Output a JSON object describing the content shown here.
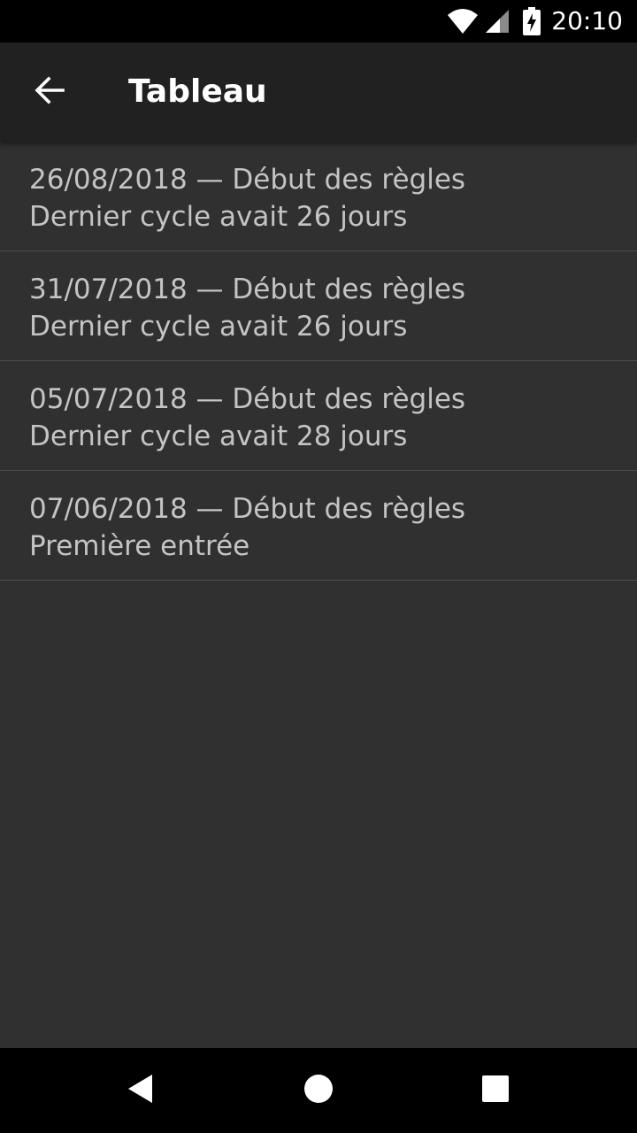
{
  "status_bar": {
    "time": "20:10",
    "icons": [
      "wifi-icon",
      "cell-signal-icon",
      "battery-charging-icon"
    ]
  },
  "app_bar": {
    "back_icon": "arrow-back-icon",
    "title": "Tableau"
  },
  "entries": [
    {
      "line1": "26/08/2018 — Début des règles",
      "line2": "Dernier cycle avait 26 jours"
    },
    {
      "line1": "31/07/2018 — Début des règles",
      "line2": "Dernier cycle avait 26 jours"
    },
    {
      "line1": "05/07/2018 — Début des règles",
      "line2": "Dernier cycle avait 28 jours"
    },
    {
      "line1": "07/06/2018 — Début des règles",
      "line2": "Première entrée"
    }
  ],
  "nav_bar": {
    "icons": [
      "back-triangle-icon",
      "home-circle-icon",
      "recents-square-icon"
    ]
  }
}
